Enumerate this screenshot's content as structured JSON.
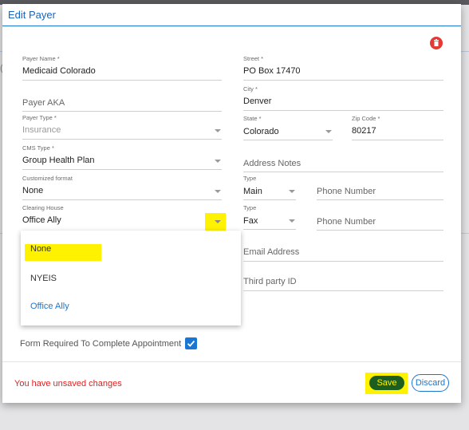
{
  "dialog": {
    "title": "Edit Payer"
  },
  "fields": {
    "payer_name": {
      "label": "Payer Name *",
      "value": "Medicaid Colorado"
    },
    "payer_aka": {
      "placeholder": "Payer AKA"
    },
    "payer_type": {
      "label": "Payer Type *",
      "value": "Insurance"
    },
    "cms_type": {
      "label": "CMS Type *",
      "value": "Group Health Plan"
    },
    "customized_format": {
      "label": "Customized format",
      "value": "None"
    },
    "clearing_house": {
      "label": "Clearing House",
      "value": "Office Ally"
    },
    "street": {
      "label": "Street *",
      "value": "PO Box 17470"
    },
    "city": {
      "label": "City *",
      "value": "Denver"
    },
    "state": {
      "label": "State *",
      "value": "Colorado"
    },
    "zip": {
      "label": "Zip Code *",
      "value": "80217"
    },
    "address_notes": {
      "placeholder": "Address Notes"
    },
    "phone_1": {
      "type_label": "Type",
      "type_value": "Main",
      "number_placeholder": "Phone Number"
    },
    "phone_2": {
      "type_label": "Type",
      "type_value": "Fax",
      "number_placeholder": "Phone Number"
    },
    "email": {
      "placeholder": "Email Address"
    },
    "third_party_id": {
      "placeholder": "Third party ID"
    }
  },
  "clearing_house_options": [
    "None",
    "NYEIS",
    "Office Ally"
  ],
  "clearing_house_selected": "Office Ally",
  "form_required": {
    "label": "Form Required To Complete Appointment",
    "checked": true
  },
  "footer": {
    "unsaved_text": "You have unsaved changes",
    "save_label": "Save",
    "discard_label": "Discard"
  },
  "colors": {
    "accent": "#1976d2",
    "highlight": "#fff200",
    "save": "#1b5e20",
    "delete": "#e53935",
    "warning": "#e02020"
  },
  "icons": [
    "trash-icon",
    "chevron-down-icon",
    "check-icon"
  ]
}
